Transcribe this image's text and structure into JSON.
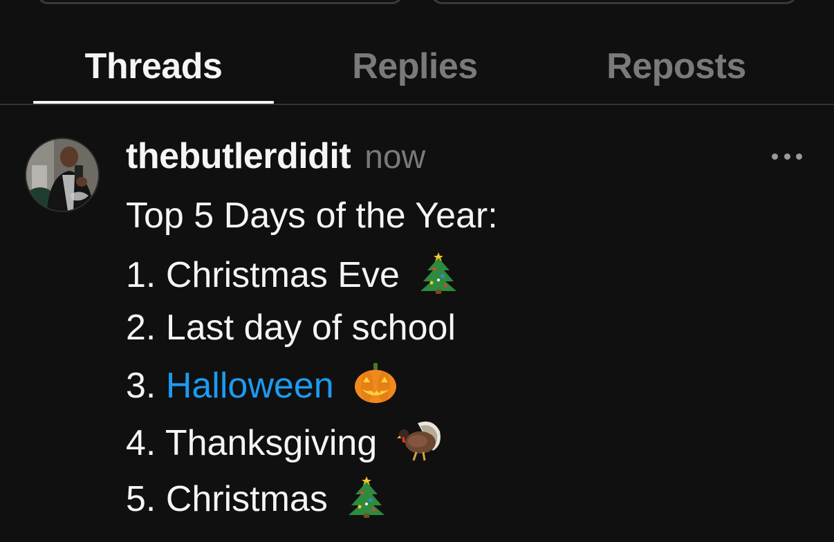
{
  "tabs": [
    {
      "label": "Threads",
      "active": true
    },
    {
      "label": "Replies",
      "active": false
    },
    {
      "label": "Reposts",
      "active": false
    }
  ],
  "post": {
    "username": "thebutlerdidit",
    "timestamp": "now",
    "more_icon": "ellipsis-icon",
    "avatar_icon": "profile-photo",
    "lines": [
      {
        "text": "Top 5 Days of the Year:"
      },
      {
        "prefix": "1. ",
        "text": "Christmas Eve",
        "emoji": "christmas-tree-icon"
      },
      {
        "prefix": "2. ",
        "text": "Last day of school"
      },
      {
        "prefix": "3. ",
        "text": "Halloween",
        "emoji": "jack-o-lantern-icon",
        "link": true
      },
      {
        "prefix": "4. ",
        "text": "Thanksgiving",
        "emoji": "turkey-icon"
      },
      {
        "prefix": "5. ",
        "text": "Christmas",
        "emoji": "christmas-tree-icon"
      }
    ]
  },
  "colors": {
    "background": "#101010",
    "text_primary": "#f3f5f7",
    "text_secondary": "#7a7a7a",
    "link": "#1d9bf0"
  }
}
